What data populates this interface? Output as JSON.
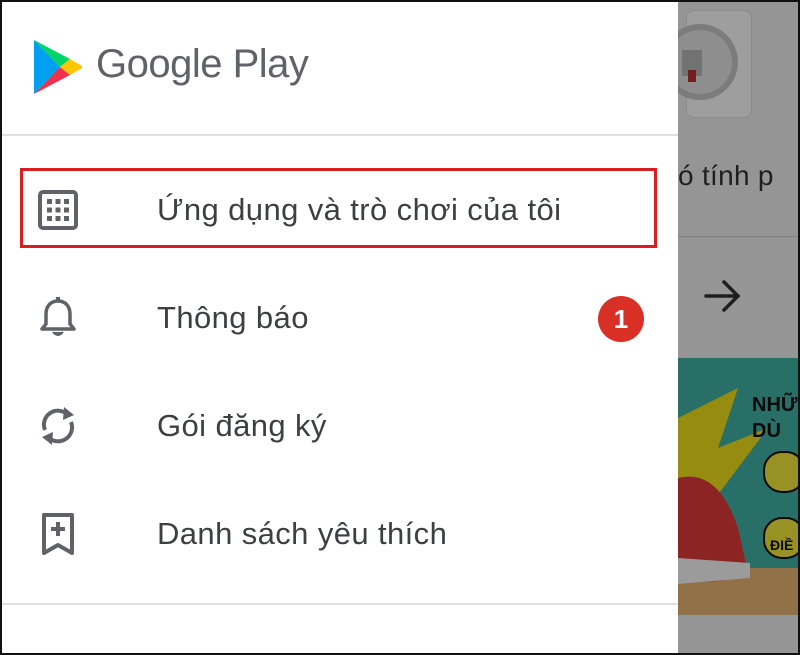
{
  "brand": {
    "name": "Google Play"
  },
  "menu": {
    "items": [
      {
        "label": "Ứng dụng và trò chơi của tôi",
        "icon": "apps-grid-icon",
        "highlighted": true
      },
      {
        "label": "Thông báo",
        "icon": "bell-icon",
        "badge": "1"
      },
      {
        "label": "Gói đăng ký",
        "icon": "refresh-icon"
      },
      {
        "label": "Danh sách yêu thích",
        "icon": "bookmark-plus-icon"
      }
    ]
  },
  "background": {
    "partial_text": "ó tính p",
    "banner_text": "NHỮ\nDÙ",
    "banner_button_text": "ĐIỀ"
  },
  "colors": {
    "highlight_border": "#d81e1e",
    "badge": "#d93025",
    "text": "#3c4043",
    "brand_text": "#5f6368"
  }
}
